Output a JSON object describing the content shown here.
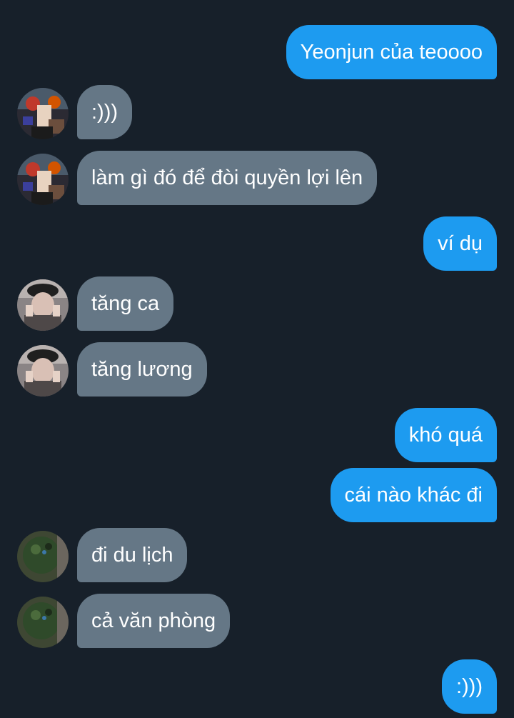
{
  "messages": [
    {
      "side": "out",
      "text": "Yeonjun của teoooo"
    },
    {
      "side": "in",
      "sender": "avatar-anime",
      "text": ":)))"
    },
    {
      "side": "in",
      "sender": "avatar-anime",
      "text": "làm gì đó để đòi quyền lợi lên"
    },
    {
      "side": "out",
      "text": "ví dụ"
    },
    {
      "side": "in",
      "sender": "avatar-cap",
      "text": "tăng ca"
    },
    {
      "side": "in",
      "sender": "avatar-cap",
      "text": "tăng lương"
    },
    {
      "side": "out",
      "text": "khó quá"
    },
    {
      "side": "out",
      "text": "cái nào khác đi"
    },
    {
      "side": "in",
      "sender": "avatar-green",
      "text": "đi du lịch"
    },
    {
      "side": "in",
      "sender": "avatar-green",
      "text": "cả văn phòng"
    },
    {
      "side": "out",
      "text": ":)))"
    }
  ],
  "colors": {
    "background": "#17202a",
    "outgoing_bubble": "#1d9bf0",
    "incoming_bubble": "#657786",
    "text": "#ffffff"
  }
}
